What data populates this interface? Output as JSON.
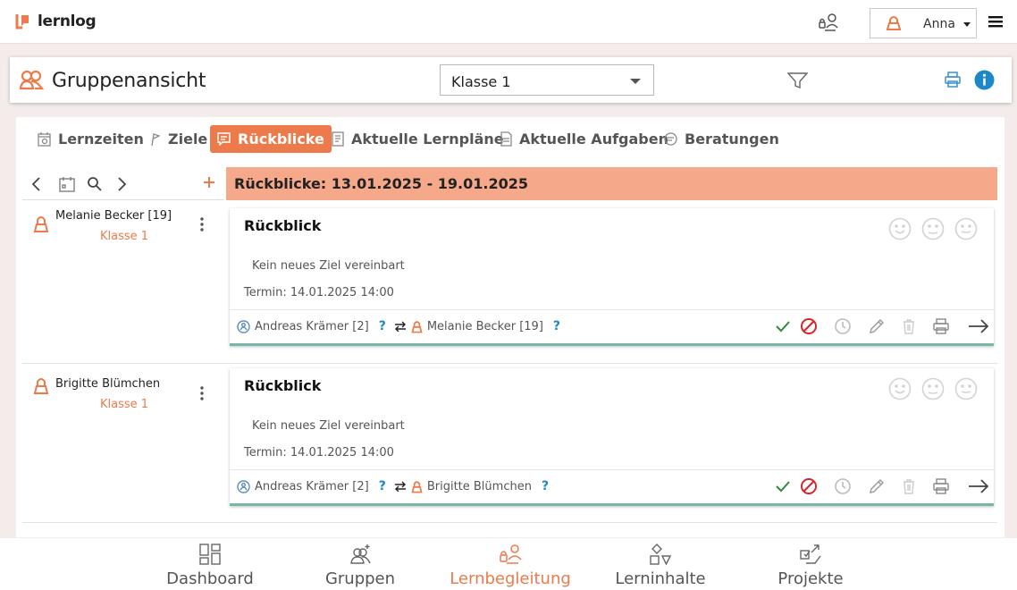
{
  "app": {
    "brand": "lernlog"
  },
  "user": {
    "name": "Anna"
  },
  "header": {
    "title": "Gruppenansicht",
    "class_value": "Klasse 1"
  },
  "tabs": [
    {
      "label": "Lernzeiten"
    },
    {
      "label": "Ziele"
    },
    {
      "label": "Rückblicke"
    },
    {
      "label": "Aktuelle Lernpläne"
    },
    {
      "label": "Aktuelle Aufgaben"
    },
    {
      "label": "Beratungen"
    }
  ],
  "range": {
    "title": "Rückblicke: 13.01.2025 - 19.01.2025"
  },
  "rows": [
    {
      "student_name": "Melanie Becker [19]",
      "student_class": "Klasse 1",
      "card_title": "Rückblick",
      "goal_text": "Kein neues Ziel vereinbart",
      "termin": "Termin: 14.01.2025 14:00",
      "teacher": "Andreas Krämer [2]",
      "learner": "Melanie Becker [19]",
      "question_mark": "?"
    },
    {
      "student_name": "Brigitte Blümchen",
      "student_class": "Klasse 1",
      "card_title": "Rückblick",
      "goal_text": "Kein neues Ziel vereinbart",
      "termin": "Termin: 14.01.2025 14:00",
      "teacher": "Andreas Krämer [2]",
      "learner": "Brigitte Blümchen",
      "question_mark": "?"
    }
  ],
  "bottom_nav": [
    {
      "label": "Dashboard"
    },
    {
      "label": "Gruppen"
    },
    {
      "label": "Lernbegleitung"
    },
    {
      "label": "Lerninhalte"
    },
    {
      "label": "Projekte"
    }
  ],
  "colors": {
    "accent": "#ec7a4a",
    "range_header": "#f5a88a",
    "info_blue": "#1c88c8",
    "check_green": "#2e8b3a",
    "reject_red": "#d6262b",
    "card_border": "#78b6a8"
  },
  "icons": {
    "top": "student-switch-icon",
    "user": "learner-icon",
    "menu": "hamburger-icon",
    "filter": "filter-icon",
    "print": "print-icon",
    "info": "info-icon"
  }
}
